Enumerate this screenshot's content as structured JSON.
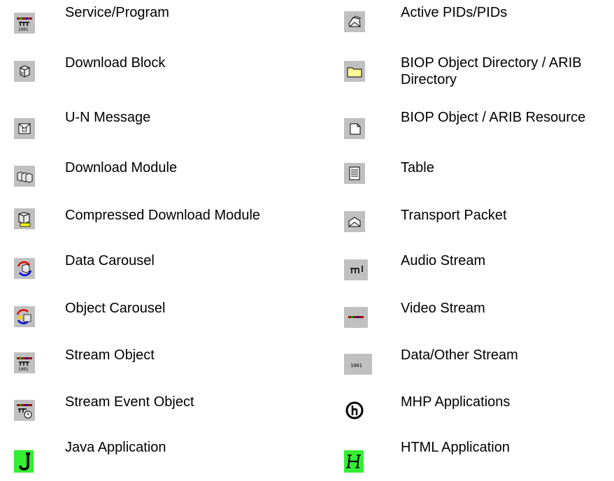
{
  "left_column": [
    {
      "label": "Service/Program",
      "icon": "service-program-icon"
    },
    {
      "label": "Download Block",
      "icon": "download-block-icon"
    },
    {
      "label": "U-N Message",
      "icon": "un-message-icon"
    },
    {
      "label": "Download Module",
      "icon": "download-module-icon"
    },
    {
      "label": "Compressed Download Module",
      "icon": "compressed-download-module-icon"
    },
    {
      "label": "Data Carousel",
      "icon": "data-carousel-icon"
    },
    {
      "label": "Object Carousel",
      "icon": "object-carousel-icon"
    },
    {
      "label": "Stream Object",
      "icon": "stream-object-icon"
    },
    {
      "label": "Stream Event Object",
      "icon": "stream-event-object-icon"
    },
    {
      "label": "Java Application",
      "icon": "java-application-icon"
    }
  ],
  "right_column": [
    {
      "label": "Active PIDs/PIDs",
      "icon": "active-pids-icon"
    },
    {
      "label": "BIOP Object Directory / ARIB Directory",
      "icon": "folder-icon"
    },
    {
      "label": "BIOP Object / ARIB Resource",
      "icon": "biop-object-icon"
    },
    {
      "label": "Table",
      "icon": "table-icon"
    },
    {
      "label": "Transport Packet",
      "icon": "transport-packet-icon"
    },
    {
      "label": "Audio Stream",
      "icon": "audio-stream-icon"
    },
    {
      "label": "Video Stream",
      "icon": "video-stream-icon"
    },
    {
      "label": "Data/Other Stream",
      "icon": "data-stream-icon"
    },
    {
      "label": "MHP Applications",
      "icon": "mhp-applications-icon"
    },
    {
      "label": "HTML Application",
      "icon": "html-application-icon"
    }
  ],
  "colors": {
    "icon_background": "#c0c0c0",
    "app_green": "#33ee33",
    "folder_yellow": "#ffff99"
  }
}
